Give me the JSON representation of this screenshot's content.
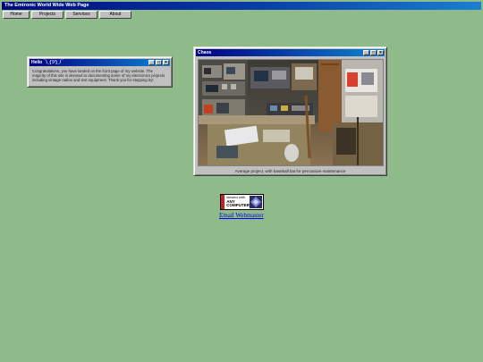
{
  "page_title": "The Emtronic World Wide Web Page",
  "nav": [
    "Home",
    "Projects",
    "Services",
    "About"
  ],
  "hello_window": {
    "title": "Hello ¯\\_(ツ)_/¯",
    "body": "Congratulations, you have landed on the front page of my website. The majority of this site is devoted to documenting some of my electronics projects including vintage radios and test equipment. Thank you for stopping by!"
  },
  "chaos_window": {
    "title": "Chaos",
    "caption": "Average project, with baseball bat for percussive maintenance"
  },
  "badge": {
    "line1": "viewed with",
    "line2": "ANY",
    "line3": "COMPUTER"
  },
  "email_link": "Email Webmaster",
  "colors": {
    "background": "#8fbb8b",
    "title_bar": "#000080",
    "link": "#0000ee"
  }
}
